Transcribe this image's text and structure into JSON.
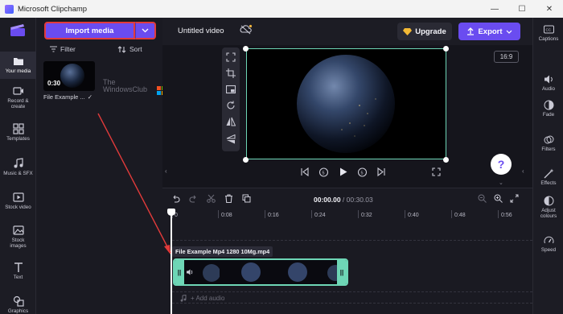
{
  "window": {
    "title": "Microsoft Clipchamp",
    "minimize": "—",
    "maximize": "☐",
    "close": "✕"
  },
  "leftnav": {
    "items": [
      {
        "label": "Your media",
        "icon": "folder-icon"
      },
      {
        "label": "Record & create",
        "icon": "record-icon"
      },
      {
        "label": "Templates",
        "icon": "templates-icon"
      },
      {
        "label": "Music & SFX",
        "icon": "music-icon"
      },
      {
        "label": "Stock video",
        "icon": "stock-video-icon"
      },
      {
        "label": "Stock images",
        "icon": "stock-images-icon"
      },
      {
        "label": "Text",
        "icon": "text-icon"
      },
      {
        "label": "Graphics",
        "icon": "graphics-icon"
      }
    ]
  },
  "media": {
    "import_label": "Import media",
    "filter_label": "Filter",
    "sort_label": "Sort",
    "thumb_duration": "0:30",
    "thumb_name": "File Example ...",
    "watermark_line1": "The",
    "watermark_line2": "WindowsClub"
  },
  "header": {
    "video_title": "Untitled video",
    "upgrade_label": "Upgrade",
    "export_label": "Export"
  },
  "preview": {
    "aspect_ratio": "16:9",
    "help": "?"
  },
  "timeline": {
    "current_time": "00:00.00",
    "separator": " / ",
    "total_time": "00:30.03",
    "ticks": [
      "0",
      "0:08",
      "0:16",
      "0:24",
      "0:32",
      "0:40",
      "0:48",
      "0:56"
    ],
    "clip_name": "File Example Mp4 1280 10Mg.mp4",
    "add_audio": "+ Add audio",
    "grip": "||"
  },
  "rightnav": {
    "items": [
      {
        "label": "Captions",
        "icon": "captions-icon"
      },
      {
        "label": "Audio",
        "icon": "audio-icon"
      },
      {
        "label": "Fade",
        "icon": "fade-icon"
      },
      {
        "label": "Filters",
        "icon": "filters-icon"
      },
      {
        "label": "Effects",
        "icon": "effects-icon"
      },
      {
        "label": "Adjust colours",
        "icon": "adjust-colours-icon"
      },
      {
        "label": "Speed",
        "icon": "speed-icon"
      }
    ]
  },
  "colors": {
    "accent": "#6a4cf0",
    "selection": "#6ed6b6",
    "annotation": "#e23b3b"
  }
}
